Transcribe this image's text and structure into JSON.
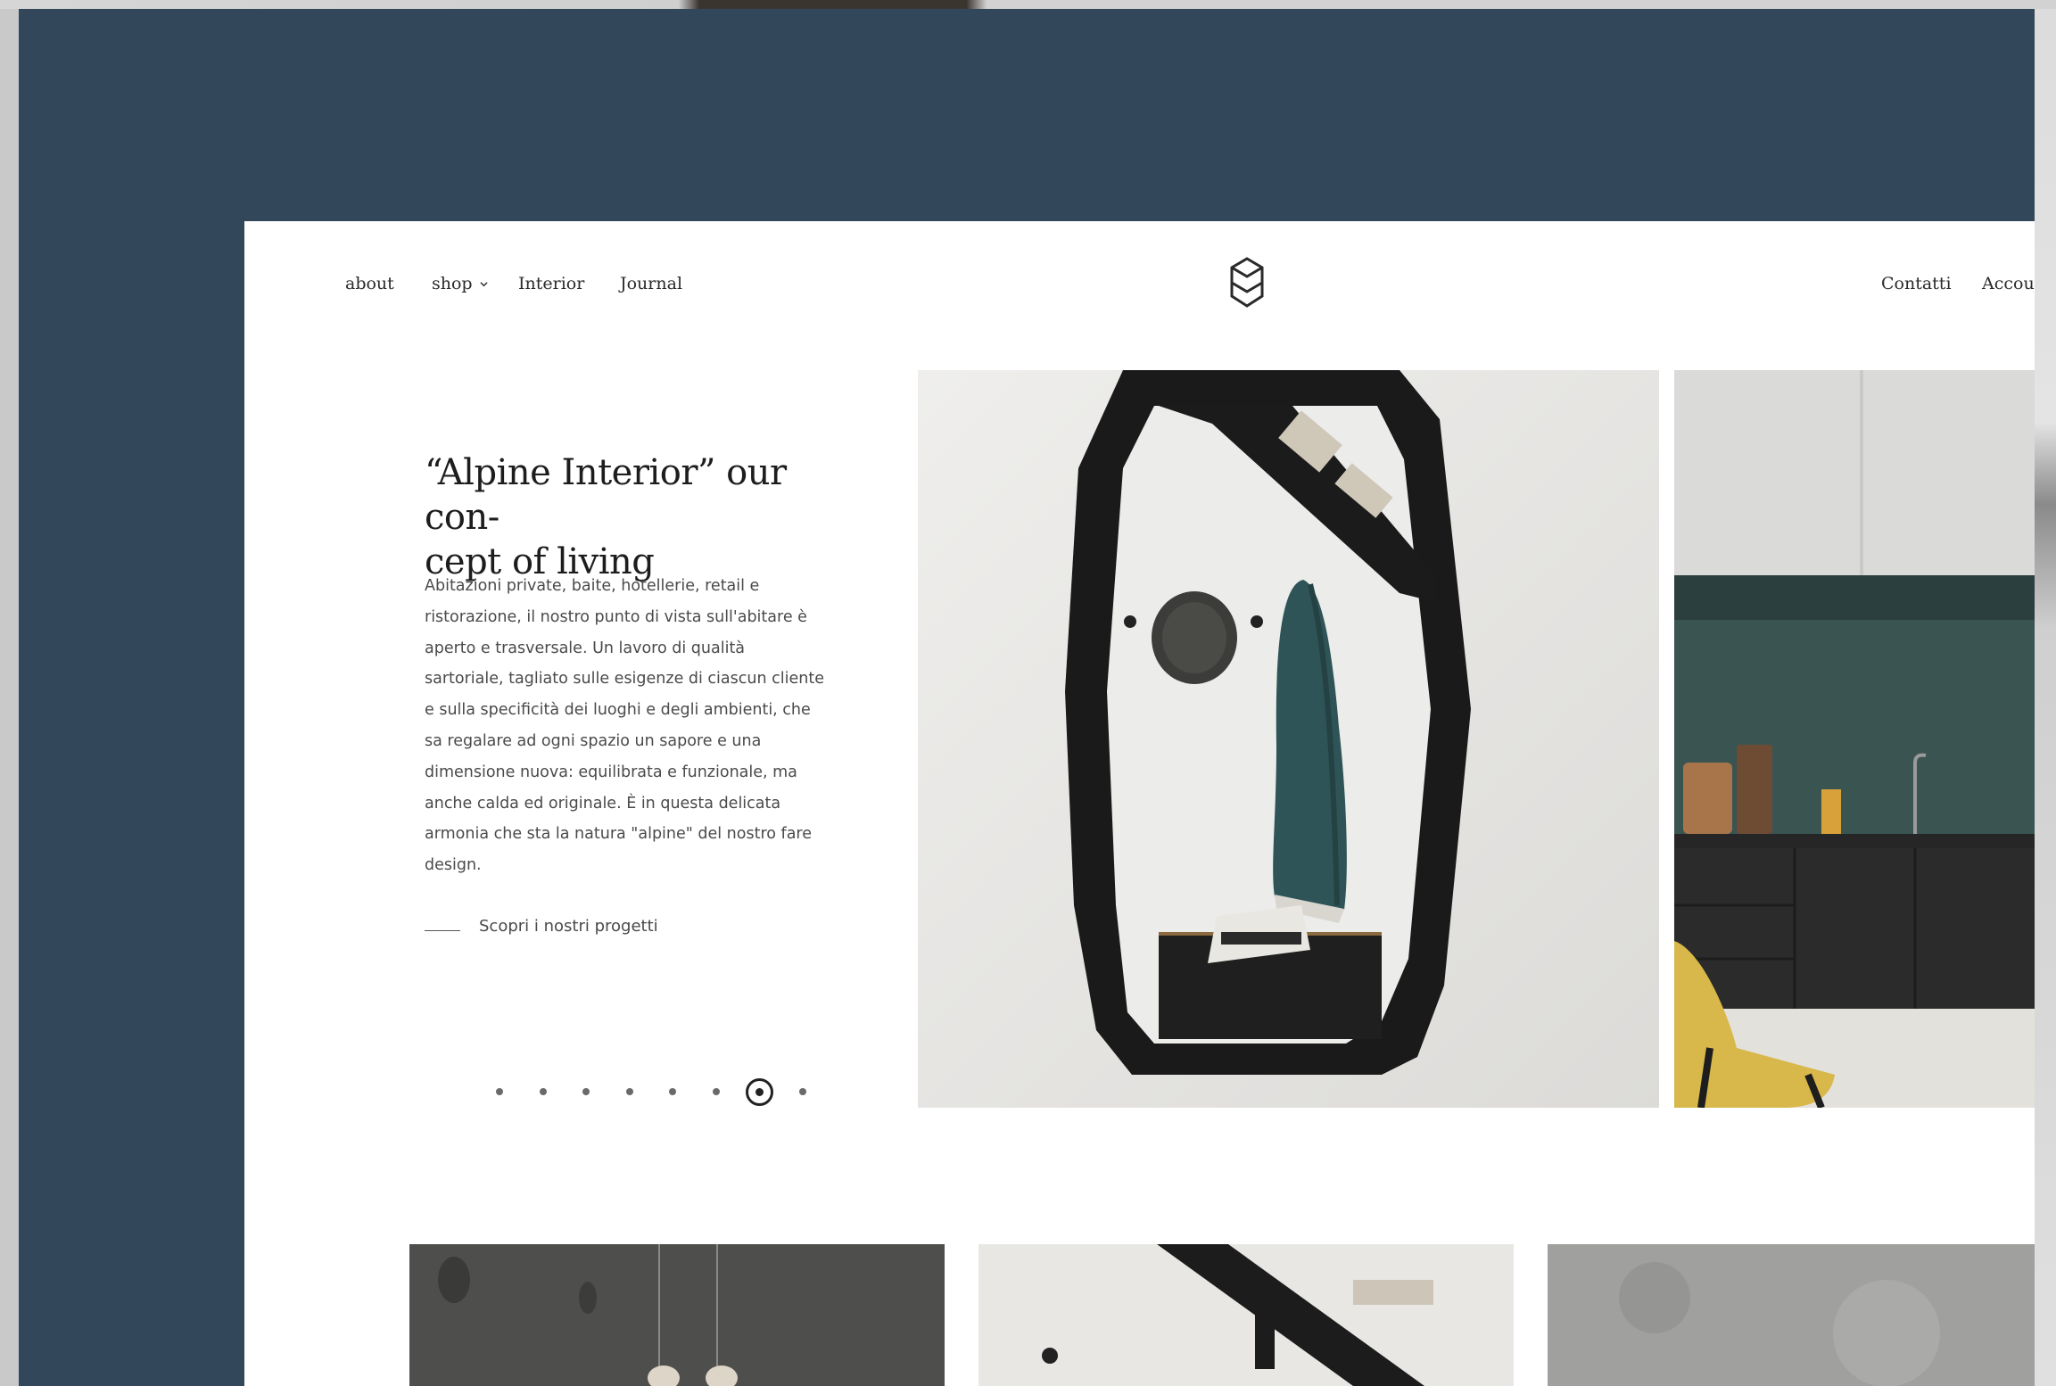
{
  "nav": {
    "left": [
      "about",
      "shop",
      "Interior",
      "Journal"
    ],
    "right": [
      "Contatti",
      "Accoun"
    ]
  },
  "hero": {
    "headline": "“Alpine Interior” our con-cept of living",
    "headline_line1": "“Alpine Interior” our con-",
    "headline_line2": "cept of living",
    "body_lines": [
      "Abitazioni private, baite, hotellerie, retail e",
      "ristorazione, il nostro punto di vista sull'abitare è",
      "aperto e trasversale. Un lavoro di qualità",
      "sartoriale, tagliato sulle esigenze di ciascun cliente",
      "e sulla specificità dei luoghi e degli ambienti, che",
      "sa regalare ad ogni spazio un sapore e una",
      "dimensione nuova: equilibrata e funzionale, ma",
      "anche calda ed originale. È in questa delicata",
      "armonia che sta la natura \"alpine\" del nostro fare",
      "design."
    ],
    "cta": "Scopri i nostri progetti"
  },
  "slider": {
    "total_slides": 8,
    "active_slide": 7
  },
  "colors": {
    "backdrop": "#33475b",
    "page": "#ffffff",
    "text": "#1d1d1d"
  },
  "icons": {
    "logo": "hexagon-logo-icon",
    "shop_dropdown": "chevron-down-icon"
  }
}
